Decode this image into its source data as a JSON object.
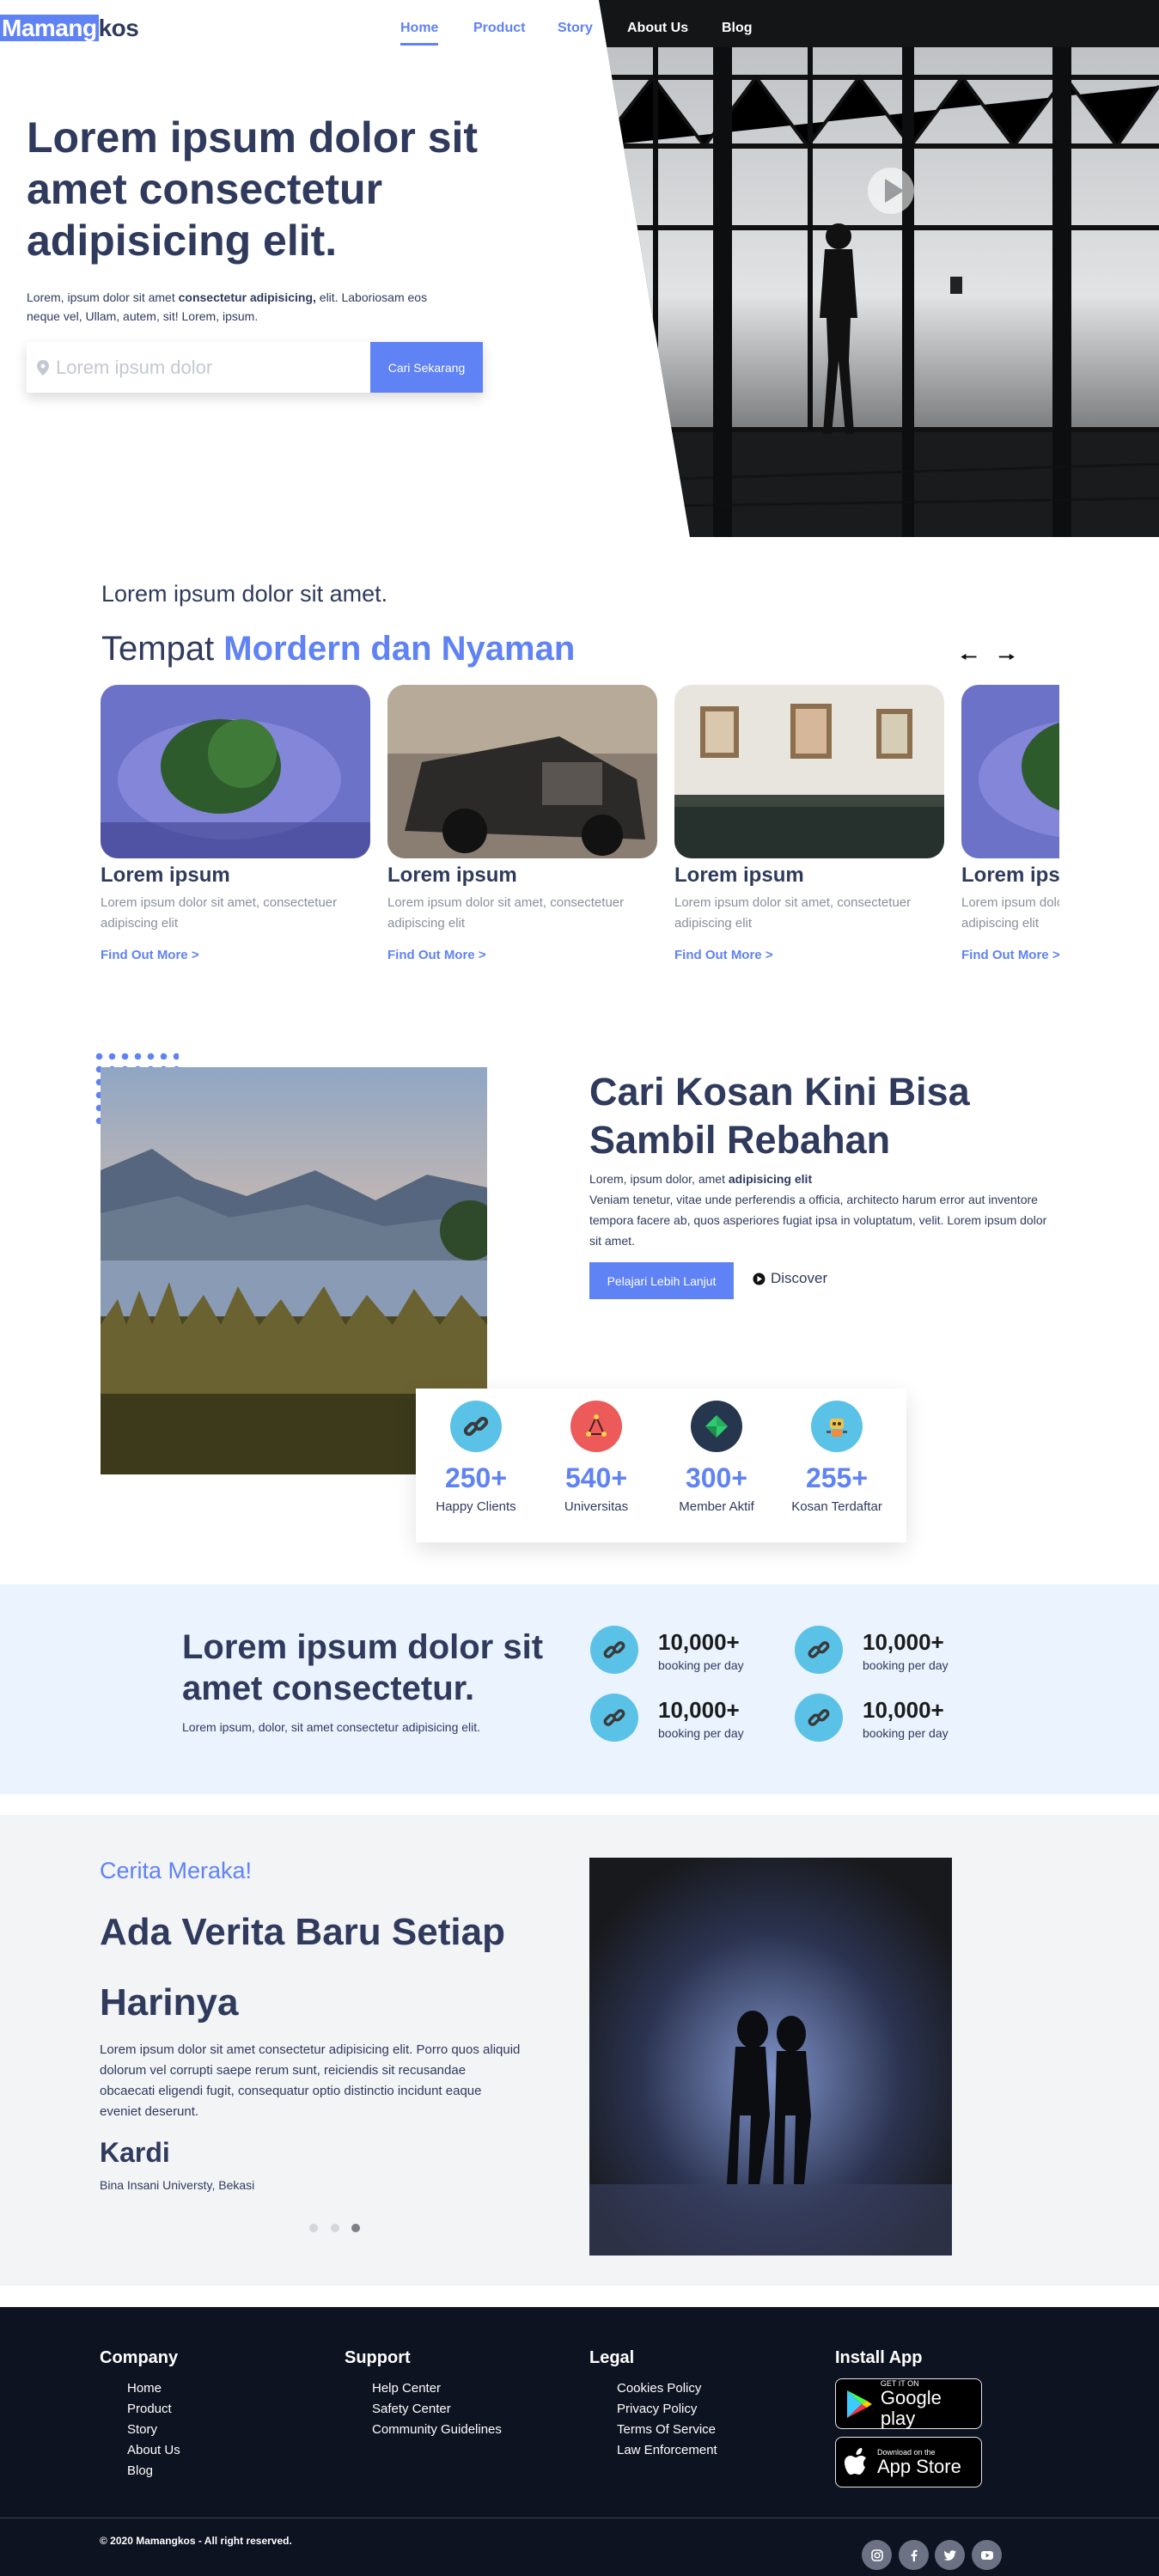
{
  "brand": {
    "highlight": "Mamang",
    "rest": "kos"
  },
  "nav": {
    "items": [
      "Home",
      "Product",
      "Story",
      "About Us",
      "Blog"
    ]
  },
  "hero": {
    "title": "Lorem ipsum dolor sit amet consectetur adipisicing elit.",
    "subtitle_pre": "Lorem, ipsum dolor sit amet ",
    "subtitle_bold": "consectetur adipisicing,",
    "subtitle_post": " elit. Laboriosam eos neque vel, Ullam, autem, sit! Lorem, ipsum.",
    "search_placeholder": "Lorem ipsum dolor",
    "search_button": "Cari Sekarang"
  },
  "places": {
    "kicker": "Lorem ipsum dolor sit amet.",
    "title_plain": "Tempat ",
    "title_accent": "Mordern dan Nyaman",
    "cards": [
      {
        "title": "Lorem ipsum",
        "desc": "Lorem ipsum dolor sit amet, consectetuer adipiscing elit",
        "link": "Find Out More >"
      },
      {
        "title": "Lorem ipsum",
        "desc": "Lorem ipsum dolor sit amet, consectetuer adipiscing elit",
        "link": "Find Out More >"
      },
      {
        "title": "Lorem ipsum",
        "desc": "Lorem ipsum dolor sit amet, consectetuer adipiscing elit",
        "link": "Find Out More >"
      },
      {
        "title": "Lorem ipsum",
        "desc": "Lorem ipsum dolor sit amet, consectetuer adipiscing elit",
        "link": "Find Out More >"
      }
    ]
  },
  "feature": {
    "title": "Cari Kosan Kini Bisa Sambil Rebahan",
    "text_pre": "Lorem, ipsum dolor, amet ",
    "text_bold": "adipisicing elit",
    "text_post": "Veniam tenetur, vitae unde perferendis a officia, architecto harum error aut inventore tempora facere ab, quos asperiores fugiat ipsa in voluptatum, velit. Lorem ipsum dolor sit amet.",
    "button": "Pelajari Lebih Lanjut",
    "discover": "Discover"
  },
  "stats": [
    {
      "value": "250+",
      "label": "Happy Clients",
      "icon": "link-icon",
      "color": "#5bc2e7"
    },
    {
      "value": "540+",
      "label": "Universitas",
      "icon": "network-icon",
      "color": "#ec5a5a"
    },
    {
      "value": "300+",
      "label": "Member Aktif",
      "icon": "gem-icon",
      "color": "#26364f"
    },
    {
      "value": "255+",
      "label": "Kosan Terdaftar",
      "icon": "robot-icon",
      "color": "#5bc2e7"
    }
  ],
  "booking": {
    "title": "Lorem ipsum dolor sit amet consectetur.",
    "subtitle": "Lorem ipsum, dolor, sit amet consectetur adipisicing elit.",
    "items": [
      {
        "value": "10,000+",
        "label": "booking per day"
      },
      {
        "value": "10,000+",
        "label": "booking per day"
      },
      {
        "value": "10,000+",
        "label": "booking per day"
      },
      {
        "value": "10,000+",
        "label": "booking per day"
      }
    ]
  },
  "story": {
    "kicker": "Cerita Meraka!",
    "title": "Ada Verita Baru Setiap Harinya",
    "text": "Lorem ipsum dolor sit amet consectetur adipisicing elit. Porro quos aliquid dolorum vel corrupti saepe rerum sunt, reiciendis sit recusandae obcaecati eligendi fugit, consequatur optio distinctio incidunt eaque eveniet deserunt.",
    "name": "Kardi",
    "role": "Bina Insani Universty, Bekasi",
    "active_dot": 3
  },
  "footer": {
    "columns": [
      {
        "title": "Company",
        "links": [
          "Home",
          "Product",
          "Story",
          "About Us",
          "Blog"
        ]
      },
      {
        "title": "Support",
        "links": [
          "Help Center",
          "Safety Center",
          "Community Guidelines"
        ]
      },
      {
        "title": "Legal",
        "links": [
          "Cookies Policy",
          "Privacy Policy",
          "Terms Of Service",
          "Law Enforcement"
        ]
      }
    ],
    "install_title": "Install App",
    "google": {
      "small": "GET IT ON",
      "big": "Google play"
    },
    "apple": {
      "small": "Download on the",
      "big": "App Store"
    },
    "copyright": "© 2020 Mamangkos - All right reserved.",
    "social": [
      "instagram-icon",
      "facebook-icon",
      "twitter-icon",
      "youtube-icon"
    ]
  },
  "colors": {
    "accent": "#5f82f5",
    "navy": "#2f3a5c",
    "footer": "#0e1321",
    "light_blue": "#eaf3fe"
  }
}
